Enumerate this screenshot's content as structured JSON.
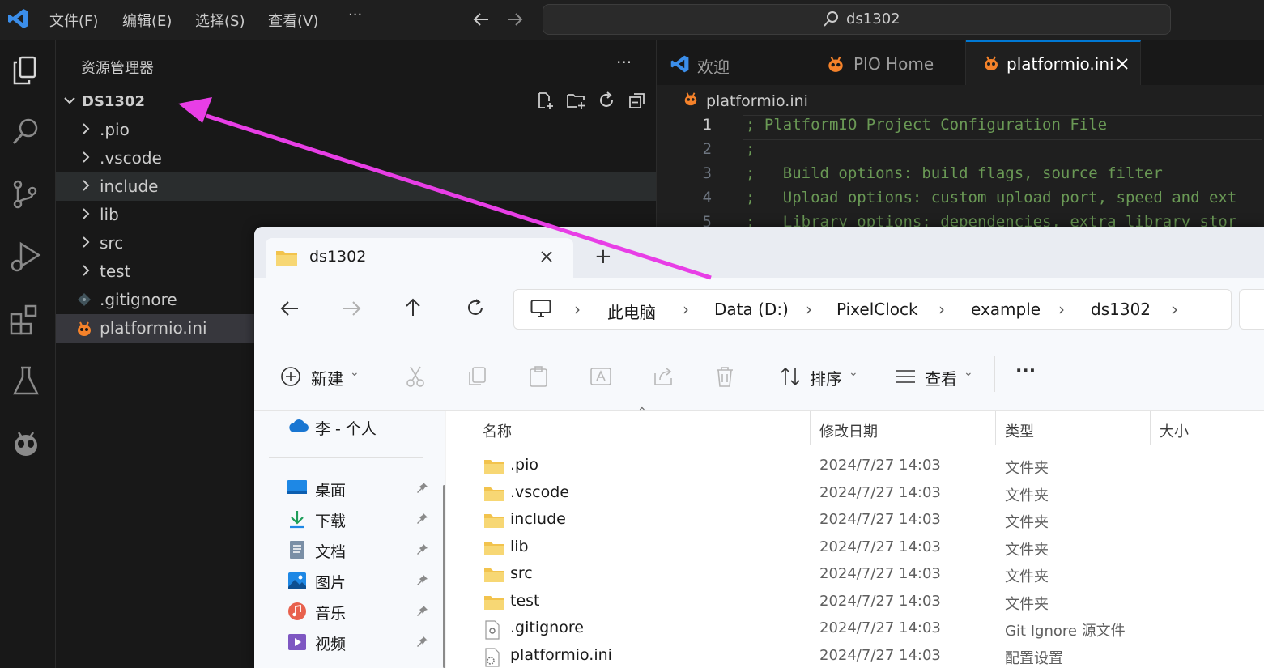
{
  "vscode": {
    "menu": [
      "文件(F)",
      "编辑(E)",
      "选择(S)",
      "查看(V)",
      "···"
    ],
    "search_text": "ds1302",
    "sidebar": {
      "title": "资源管理器",
      "more": "···",
      "folder": "DS1302",
      "items": [
        {
          "label": ".pio",
          "type": "folder"
        },
        {
          "label": ".vscode",
          "type": "folder"
        },
        {
          "label": "include",
          "type": "folder"
        },
        {
          "label": "lib",
          "type": "folder"
        },
        {
          "label": "src",
          "type": "folder"
        },
        {
          "label": "test",
          "type": "folder"
        },
        {
          "label": ".gitignore",
          "type": "file"
        },
        {
          "label": "platformio.ini",
          "type": "file"
        }
      ]
    },
    "tabs": [
      {
        "label": "欢迎"
      },
      {
        "label": "PIO Home"
      },
      {
        "label": "platformio.ini",
        "active": true
      }
    ],
    "breadcrumb": "platformio.ini",
    "code_lines": [
      {
        "n": "1",
        "text": "; PlatformIO Project Configuration File"
      },
      {
        "n": "2",
        "text": ";"
      },
      {
        "n": "3",
        "text": ";   Build options: build flags, source filter"
      },
      {
        "n": "4",
        "text": ";   Upload options: custom upload port, speed and ext"
      },
      {
        "n": "5",
        "text": ";   Library options: dependencies, extra library stor"
      }
    ]
  },
  "explorer": {
    "tab_title": "ds1302",
    "new_tab": "+",
    "breadcrumbs": [
      "此电脑",
      "Data (D:)",
      "PixelClock",
      "example",
      "ds1302"
    ],
    "commands": {
      "new": "新建",
      "sort": "排序",
      "view": "查看",
      "more": "···"
    },
    "nav": {
      "cloud": "李 - 个人",
      "quick": [
        {
          "label": "桌面",
          "icon": "desktop-icon"
        },
        {
          "label": "下载",
          "icon": "download-icon"
        },
        {
          "label": "文档",
          "icon": "document-icon"
        },
        {
          "label": "图片",
          "icon": "pictures-icon"
        },
        {
          "label": "音乐",
          "icon": "music-icon"
        },
        {
          "label": "视频",
          "icon": "video-icon"
        }
      ]
    },
    "columns": [
      "名称",
      "修改日期",
      "类型",
      "大小"
    ],
    "files": [
      {
        "name": ".pio",
        "date": "2024/7/27 14:03",
        "type": "文件夹",
        "kind": "folder"
      },
      {
        "name": ".vscode",
        "date": "2024/7/27 14:03",
        "type": "文件夹",
        "kind": "folder"
      },
      {
        "name": "include",
        "date": "2024/7/27 14:03",
        "type": "文件夹",
        "kind": "folder"
      },
      {
        "name": "lib",
        "date": "2024/7/27 14:03",
        "type": "文件夹",
        "kind": "folder"
      },
      {
        "name": "src",
        "date": "2024/7/27 14:03",
        "type": "文件夹",
        "kind": "folder"
      },
      {
        "name": "test",
        "date": "2024/7/27 14:03",
        "type": "文件夹",
        "kind": "folder"
      },
      {
        "name": ".gitignore",
        "date": "2024/7/27 14:03",
        "type": "Git Ignore 源文件",
        "kind": "file"
      },
      {
        "name": "platformio.ini",
        "date": "2024/7/27 14:03",
        "type": "配置设置",
        "kind": "settings"
      }
    ]
  },
  "colors": {
    "arrow": "#e83ee6",
    "vscode_blue": "#3b8eea",
    "folder_yellow": "#f2c34d",
    "pio_orange": "#f5822a"
  }
}
